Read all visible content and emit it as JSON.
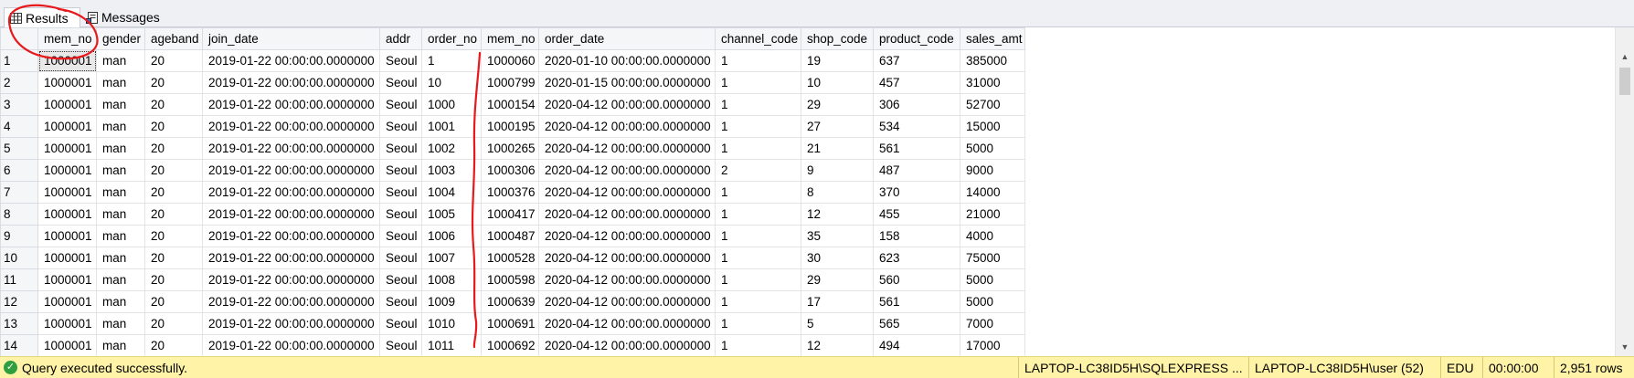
{
  "tabs": [
    {
      "label": "Results",
      "icon": "grid-icon"
    },
    {
      "label": "Messages",
      "icon": "messages-icon"
    }
  ],
  "columns": [
    "mem_no",
    "gender",
    "ageband",
    "join_date",
    "addr",
    "order_no",
    "mem_no",
    "order_date",
    "channel_code",
    "shop_code",
    "product_code",
    "sales_amt"
  ],
  "rows": [
    [
      "1",
      "1000001",
      "man",
      "20",
      "2019-01-22 00:00:00.0000000",
      "Seoul",
      "1",
      "1000060",
      "2020-01-10 00:00:00.0000000",
      "1",
      "19",
      "637",
      "385000"
    ],
    [
      "2",
      "1000001",
      "man",
      "20",
      "2019-01-22 00:00:00.0000000",
      "Seoul",
      "10",
      "1000799",
      "2020-01-15 00:00:00.0000000",
      "1",
      "10",
      "457",
      "31000"
    ],
    [
      "3",
      "1000001",
      "man",
      "20",
      "2019-01-22 00:00:00.0000000",
      "Seoul",
      "1000",
      "1000154",
      "2020-04-12 00:00:00.0000000",
      "1",
      "29",
      "306",
      "52700"
    ],
    [
      "4",
      "1000001",
      "man",
      "20",
      "2019-01-22 00:00:00.0000000",
      "Seoul",
      "1001",
      "1000195",
      "2020-04-12 00:00:00.0000000",
      "1",
      "27",
      "534",
      "15000"
    ],
    [
      "5",
      "1000001",
      "man",
      "20",
      "2019-01-22 00:00:00.0000000",
      "Seoul",
      "1002",
      "1000265",
      "2020-04-12 00:00:00.0000000",
      "1",
      "21",
      "561",
      "5000"
    ],
    [
      "6",
      "1000001",
      "man",
      "20",
      "2019-01-22 00:00:00.0000000",
      "Seoul",
      "1003",
      "1000306",
      "2020-04-12 00:00:00.0000000",
      "2",
      "9",
      "487",
      "9000"
    ],
    [
      "7",
      "1000001",
      "man",
      "20",
      "2019-01-22 00:00:00.0000000",
      "Seoul",
      "1004",
      "1000376",
      "2020-04-12 00:00:00.0000000",
      "1",
      "8",
      "370",
      "14000"
    ],
    [
      "8",
      "1000001",
      "man",
      "20",
      "2019-01-22 00:00:00.0000000",
      "Seoul",
      "1005",
      "1000417",
      "2020-04-12 00:00:00.0000000",
      "1",
      "12",
      "455",
      "21000"
    ],
    [
      "9",
      "1000001",
      "man",
      "20",
      "2019-01-22 00:00:00.0000000",
      "Seoul",
      "1006",
      "1000487",
      "2020-04-12 00:00:00.0000000",
      "1",
      "35",
      "158",
      "4000"
    ],
    [
      "10",
      "1000001",
      "man",
      "20",
      "2019-01-22 00:00:00.0000000",
      "Seoul",
      "1007",
      "1000528",
      "2020-04-12 00:00:00.0000000",
      "1",
      "30",
      "623",
      "75000"
    ],
    [
      "11",
      "1000001",
      "man",
      "20",
      "2019-01-22 00:00:00.0000000",
      "Seoul",
      "1008",
      "1000598",
      "2020-04-12 00:00:00.0000000",
      "1",
      "29",
      "560",
      "5000"
    ],
    [
      "12",
      "1000001",
      "man",
      "20",
      "2019-01-22 00:00:00.0000000",
      "Seoul",
      "1009",
      "1000639",
      "2020-04-12 00:00:00.0000000",
      "1",
      "17",
      "561",
      "5000"
    ],
    [
      "13",
      "1000001",
      "man",
      "20",
      "2019-01-22 00:00:00.0000000",
      "Seoul",
      "1010",
      "1000691",
      "2020-04-12 00:00:00.0000000",
      "1",
      "5",
      "565",
      "7000"
    ],
    [
      "14",
      "1000001",
      "man",
      "20",
      "2019-01-22 00:00:00.0000000",
      "Seoul",
      "1011",
      "1000692",
      "2020-04-12 00:00:00.0000000",
      "1",
      "12",
      "494",
      "17000"
    ]
  ],
  "status": {
    "message": "Query executed successfully.",
    "server": "LAPTOP-LC38ID5H\\SQLEXPRESS ...",
    "user": "LAPTOP-LC38ID5H\\user (52)",
    "database": "EDU",
    "elapsed": "00:00:00",
    "rowcount": "2,951 rows"
  },
  "colors": {
    "status_bar": "#fff3a8",
    "annotation": "#e8191c",
    "success": "#2e9e3e"
  }
}
